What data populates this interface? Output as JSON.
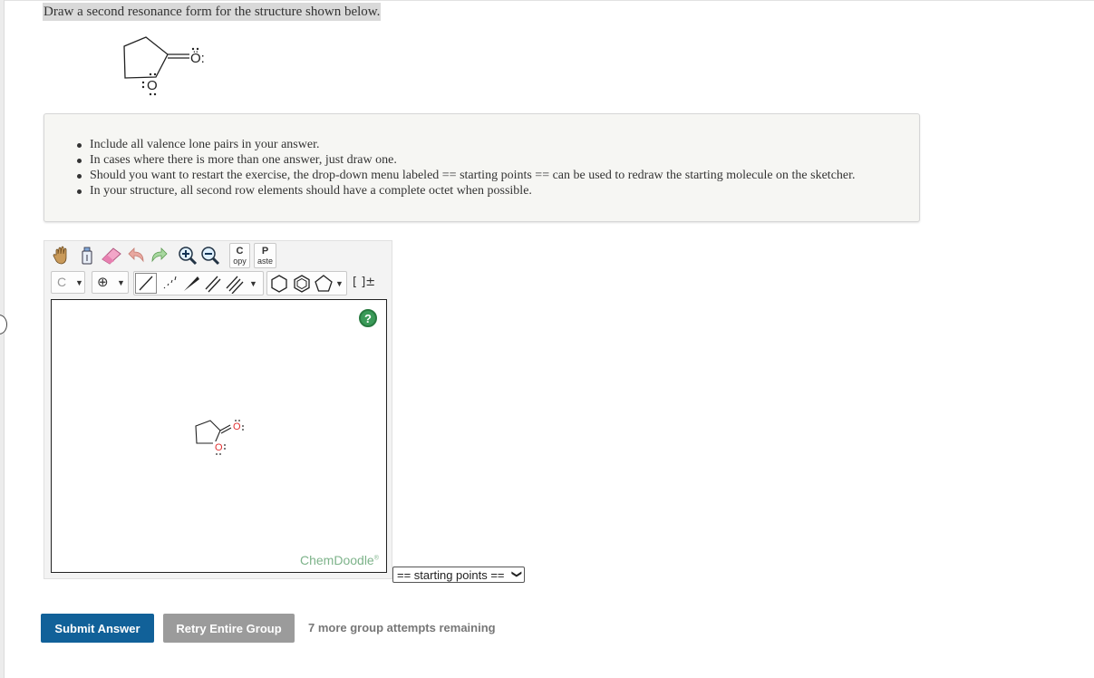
{
  "question": {
    "prompt": "Draw a second resonance form for the structure shown below."
  },
  "structure": {
    "exocyclic_atom": "Ö:",
    "ring_atom": "O"
  },
  "instructions": {
    "items": [
      "Include all valence lone pairs in your answer.",
      "In cases where there is more than one answer, just draw one.",
      "Should you want to restart the exercise, the drop-down menu labeled == starting points == can be used to redraw the starting molecule on the sketcher.",
      "In your structure, all second row elements should have a complete octet when possible."
    ]
  },
  "sketcher": {
    "toolbar_row1": {
      "copy_top": "C",
      "copy_bottom": "opy",
      "paste_top": "P",
      "paste_bottom": "aste"
    },
    "toolbar_row2": {
      "element_label": "C",
      "charge_symbol": "⊕",
      "bracket_label": "[ ]±"
    },
    "canvas": {
      "help_label": "?",
      "brand": "ChemDoodle",
      "brand_mark": "®"
    },
    "starting_points_select": "== starting points =="
  },
  "actions": {
    "submit_label": "Submit Answer",
    "retry_label": "Retry Entire Group",
    "attempts_text": "7 more group attempts remaining"
  },
  "colors": {
    "submit_bg": "#116199",
    "retry_bg": "#9b9b9b",
    "brand_green": "#7db38a",
    "help_green": "#3a9a58"
  }
}
